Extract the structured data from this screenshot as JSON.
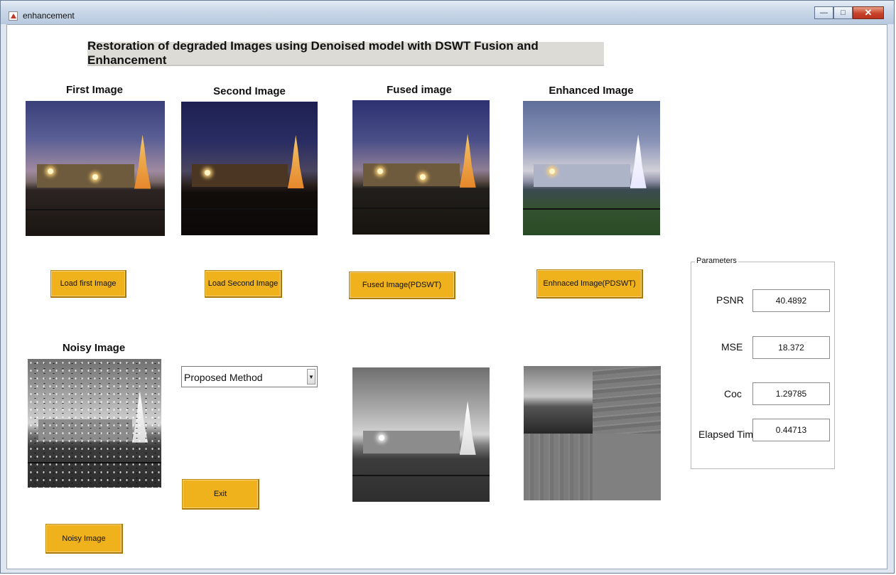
{
  "window": {
    "title": "enhancement"
  },
  "heading": "Restoration of degraded Images using Denoised model with DSWT Fusion and Enhancement",
  "panels": {
    "first": {
      "title": "First Image",
      "button": "Load first Image"
    },
    "second": {
      "title": "Second Image",
      "button": "Load Second Image"
    },
    "fused": {
      "title": "Fused image",
      "button": "Fused Image(PDSWT)"
    },
    "enhanced": {
      "title": "Enhanced Image",
      "button": "Enhnaced Image(PDSWT)"
    },
    "noisy": {
      "title": "Noisy Image",
      "button": "Noisy Image"
    }
  },
  "method_select": {
    "selected": "Proposed Method"
  },
  "exit_button": "Exit",
  "parameters": {
    "legend": "Parameters",
    "rows": [
      {
        "label": "PSNR",
        "value": "40.4892"
      },
      {
        "label": "MSE",
        "value": "18.372"
      },
      {
        "label": "Coc",
        "value": "1.29785"
      },
      {
        "label": "Elapsed Time",
        "value": "0.44713"
      }
    ]
  },
  "colors": {
    "button_gold": "#f0b21c",
    "heading_bg": "#dcdbd6"
  }
}
